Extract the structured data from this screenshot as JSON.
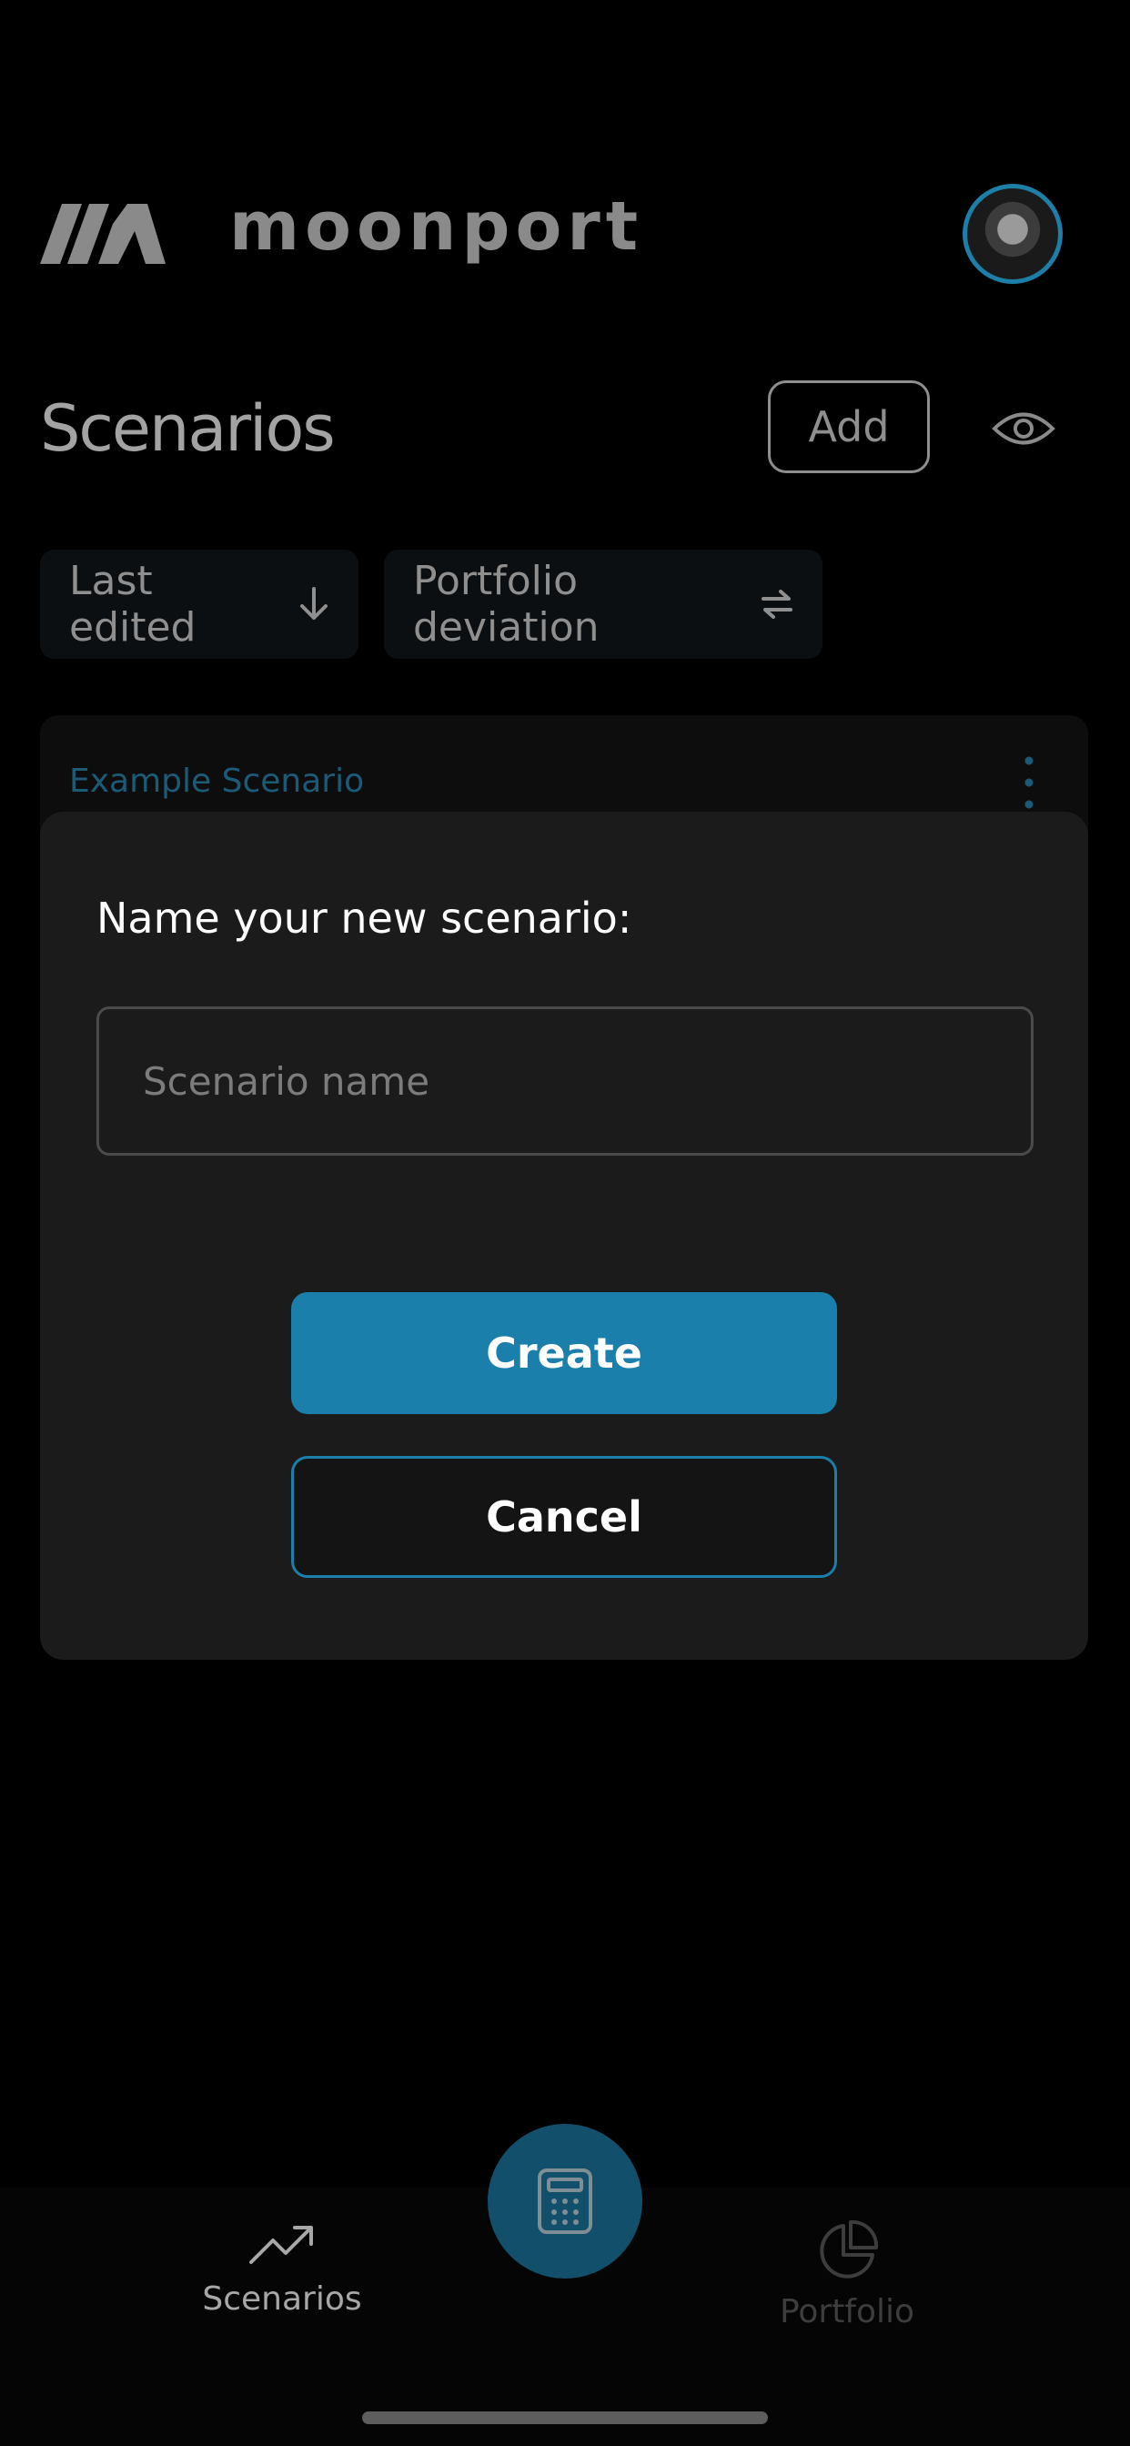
{
  "header": {
    "brand": "moonport",
    "logo_icon": "moonport-logo-icon",
    "avatar_icon": "astronaut-avatar"
  },
  "scenarios": {
    "title": "Scenarios",
    "add_label": "Add",
    "visibility_icon": "eye-icon",
    "sort_chips": [
      {
        "label": "Last edited",
        "icon": "arrow-down-icon"
      },
      {
        "label": "Portfolio deviation",
        "icon": "swap-arrows-icon"
      }
    ],
    "card": {
      "title": "Example Scenario",
      "menu_icon": "kebab-menu-icon"
    }
  },
  "modal": {
    "label": "Name your new scenario:",
    "input_placeholder": "Scenario name",
    "input_value": "",
    "create_label": "Create",
    "cancel_label": "Cancel"
  },
  "bottom_nav": {
    "items": [
      {
        "label": "Scenarios",
        "icon": "trending-up-icon"
      },
      {
        "label": "Portfolio",
        "icon": "pie-chart-icon"
      }
    ],
    "center_icon": "calculator-icon"
  },
  "colors": {
    "accent": "#1b7fac",
    "background": "#000000",
    "modal": "#1b1b1b"
  }
}
